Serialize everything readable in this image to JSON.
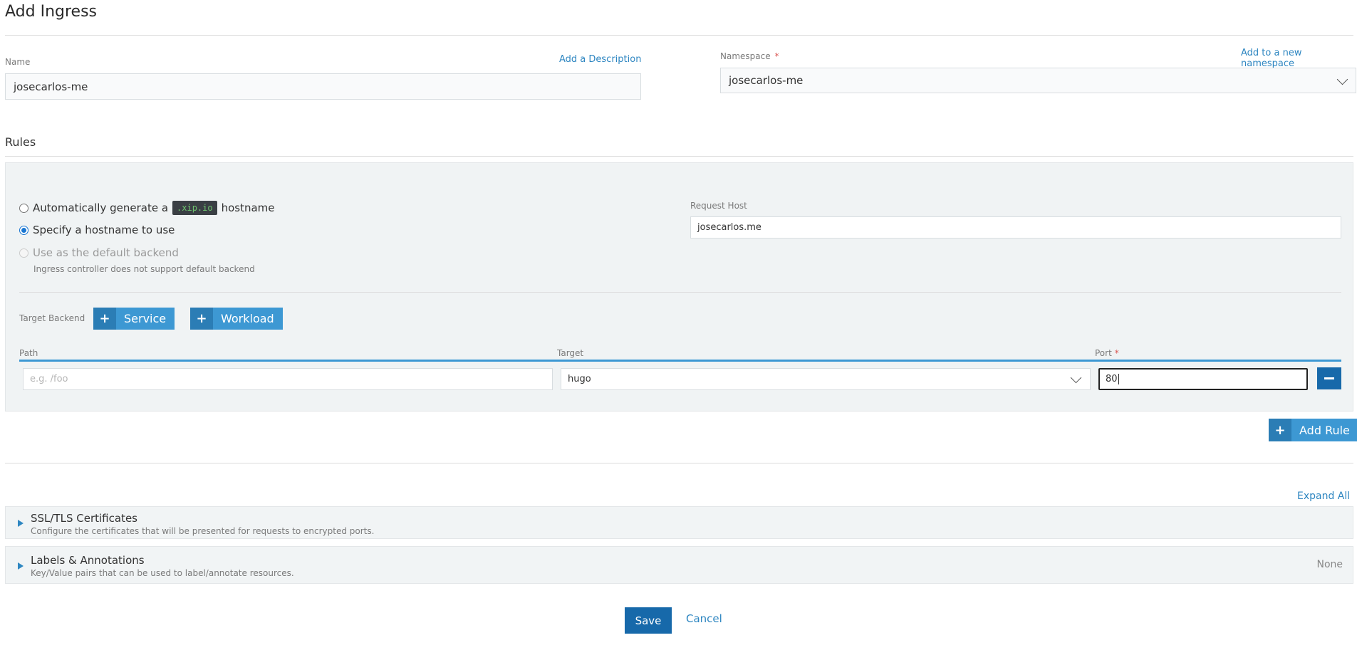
{
  "page": {
    "title": "Add Ingress"
  },
  "name_field": {
    "label": "Name",
    "value": "josecarlos-me",
    "add_description_link": "Add a Description"
  },
  "namespace_field": {
    "label": "Namespace",
    "required_mark": "*",
    "value": "josecarlos-me",
    "add_namespace_link": "Add to a new namespace"
  },
  "rules": {
    "title": "Rules",
    "options": [
      {
        "label_before": "Automatically generate a",
        "code": ".xip.io",
        "label_after": "hostname",
        "selected": false,
        "disabled": false
      },
      {
        "label": "Specify a hostname to use",
        "selected": true,
        "disabled": false
      },
      {
        "label": "Use as the default backend",
        "selected": false,
        "disabled": true,
        "help": "Ingress controller does not support default backend"
      }
    ],
    "request_host": {
      "label": "Request Host",
      "value": "josecarlos.me"
    },
    "target_backend": {
      "label": "Target Backend",
      "service_button": "Service",
      "workload_button": "Workload"
    },
    "columns": {
      "path": "Path",
      "target": "Target",
      "port": "Port",
      "port_required": "*"
    },
    "row": {
      "path_placeholder": "e.g. /foo",
      "path_value": "",
      "target_value": "hugo",
      "port_value": "80"
    },
    "add_rule_button": "Add Rule"
  },
  "expand_all_link": "Expand All",
  "sections": [
    {
      "title": "SSL/TLS Certificates",
      "description": "Configure the certificates that will be presented for requests to encrypted ports.",
      "status": ""
    },
    {
      "title": "Labels & Annotations",
      "description": "Key/Value pairs that can be used to label/annotate resources.",
      "status": "None"
    }
  ],
  "footer": {
    "save_label": "Save",
    "cancel_label": "Cancel"
  },
  "colors": {
    "accent": "#3d98d3",
    "primary_dark": "#1769aa",
    "link": "#2e86c1",
    "required": "#d9534f"
  },
  "icons": {
    "plus": "plus-icon",
    "minus": "minus-icon",
    "chevron": "chevron-down-icon",
    "triangle": "expand-triangle-icon"
  }
}
